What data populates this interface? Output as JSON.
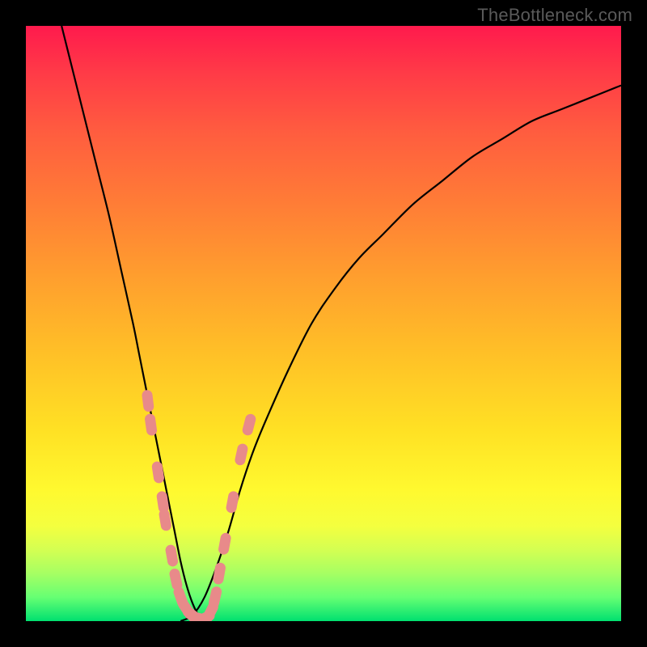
{
  "watermark": "TheBottleneck.com",
  "chart_data": {
    "type": "line",
    "title": "",
    "xlabel": "",
    "ylabel": "",
    "xlim": [
      0,
      100
    ],
    "ylim": [
      0,
      100
    ],
    "note": "V-shaped bottleneck curve; y ≈ 100 is worst (red), y ≈ 0 is best (green). Two curves meeting near x ≈ 27.",
    "series": [
      {
        "name": "left-branch",
        "x": [
          6,
          8,
          10,
          12,
          14,
          16,
          18,
          19,
          20,
          21,
          22,
          23,
          24,
          25,
          26,
          27,
          28,
          29,
          30,
          31
        ],
        "y": [
          100,
          92,
          84,
          76,
          68,
          59,
          50,
          45,
          40,
          35,
          30,
          25,
          20,
          15,
          10,
          6,
          3,
          1,
          0,
          0
        ]
      },
      {
        "name": "right-branch",
        "x": [
          26,
          28,
          30,
          32,
          34,
          36,
          38,
          40,
          44,
          48,
          52,
          56,
          60,
          65,
          70,
          75,
          80,
          85,
          90,
          95,
          100
        ],
        "y": [
          0,
          1,
          4,
          9,
          15,
          22,
          28,
          33,
          42,
          50,
          56,
          61,
          65,
          70,
          74,
          78,
          81,
          84,
          86,
          88,
          90
        ]
      }
    ],
    "highlight_points": {
      "name": "measured-samples",
      "description": "Pink sample markers clustered near the minimum of the V",
      "points": [
        {
          "x": 20.5,
          "y": 37
        },
        {
          "x": 21.0,
          "y": 33
        },
        {
          "x": 22.2,
          "y": 25
        },
        {
          "x": 23.0,
          "y": 20
        },
        {
          "x": 23.4,
          "y": 17
        },
        {
          "x": 24.5,
          "y": 11
        },
        {
          "x": 25.2,
          "y": 7
        },
        {
          "x": 26.0,
          "y": 4
        },
        {
          "x": 27.0,
          "y": 2
        },
        {
          "x": 28.0,
          "y": 1
        },
        {
          "x": 29.0,
          "y": 0.5
        },
        {
          "x": 30.0,
          "y": 0.5
        },
        {
          "x": 31.0,
          "y": 1.5
        },
        {
          "x": 31.8,
          "y": 4
        },
        {
          "x": 32.5,
          "y": 8
        },
        {
          "x": 33.4,
          "y": 13
        },
        {
          "x": 34.7,
          "y": 20
        },
        {
          "x": 36.2,
          "y": 28
        },
        {
          "x": 37.5,
          "y": 33
        }
      ]
    }
  }
}
